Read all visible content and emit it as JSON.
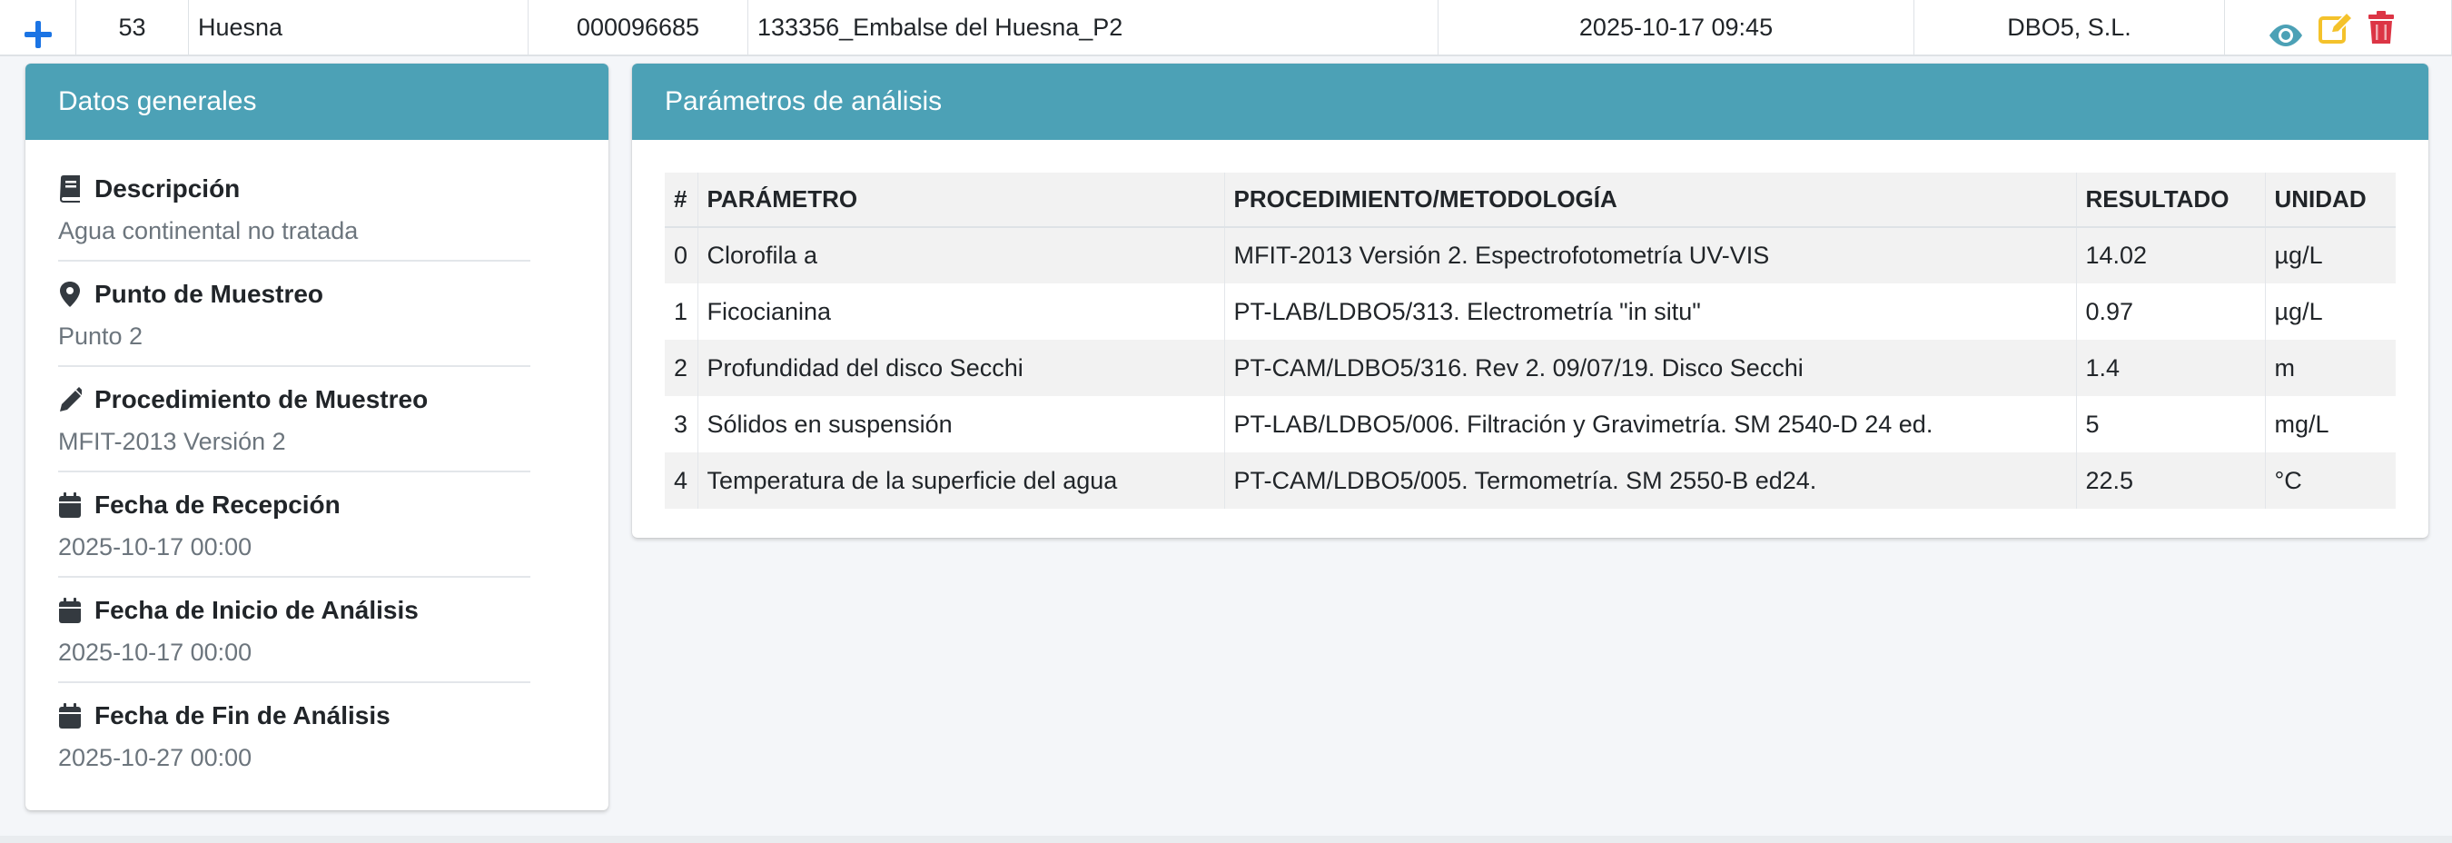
{
  "row": {
    "number": "53",
    "name": "Huesna",
    "code": "000096685",
    "description": "133356_Embalse del Huesna_P2",
    "datetime": "2025-10-17 09:45",
    "company": "DBO5, S.L.",
    "actions": [
      "view-icon",
      "edit-icon",
      "delete-icon"
    ]
  },
  "colors": {
    "header": "#4ca1b6",
    "view": "#4ca1b6",
    "edit": "#f4c22b",
    "delete": "#dc3545",
    "plus": "#1b74e4"
  },
  "general": {
    "title": "Datos generales",
    "items": [
      {
        "icon": "book-icon",
        "label": "Descripción",
        "value": "Agua continental no tratada"
      },
      {
        "icon": "map-marker-icon",
        "label": "Punto de Muestreo",
        "value": "Punto 2"
      },
      {
        "icon": "pencil-icon",
        "label": "Procedimiento de Muestreo",
        "value": "MFIT-2013 Versión 2"
      },
      {
        "icon": "calendar-icon",
        "label": "Fecha de Recepción",
        "value": "2025-10-17 00:00"
      },
      {
        "icon": "calendar-icon",
        "label": "Fecha de Inicio de Análisis",
        "value": "2025-10-17 00:00"
      },
      {
        "icon": "calendar-icon",
        "label": "Fecha de Fin de Análisis",
        "value": "2025-10-27 00:00"
      }
    ]
  },
  "params": {
    "title": "Parámetros de análisis",
    "headers": [
      "#",
      "PARÁMETRO",
      "PROCEDIMIENTO/METODOLOGÍA",
      "RESULTADO",
      "UNIDAD"
    ],
    "rows": [
      [
        "0",
        "Clorofila a",
        "MFIT-2013 Versión 2. Espectrofotometría UV-VIS",
        "14.02",
        "µg/L"
      ],
      [
        "1",
        "Ficocianina",
        "PT-LAB/LDBO5/313. Electrometría \"in situ\"",
        "0.97",
        "µg/L"
      ],
      [
        "2",
        "Profundidad del disco Secchi",
        "PT-CAM/LDBO5/316. Rev 2. 09/07/19. Disco Secchi",
        "1.4",
        "m"
      ],
      [
        "3",
        "Sólidos en suspensión",
        "PT-LAB/LDBO5/006. Filtración y Gravimetría. SM 2540-D 24 ed.",
        "5",
        "mg/L"
      ],
      [
        "4",
        "Temperatura de la superficie del agua",
        "PT-CAM/LDBO5/005. Termometría. SM 2550-B ed24.",
        "22.5",
        "°C"
      ]
    ]
  }
}
